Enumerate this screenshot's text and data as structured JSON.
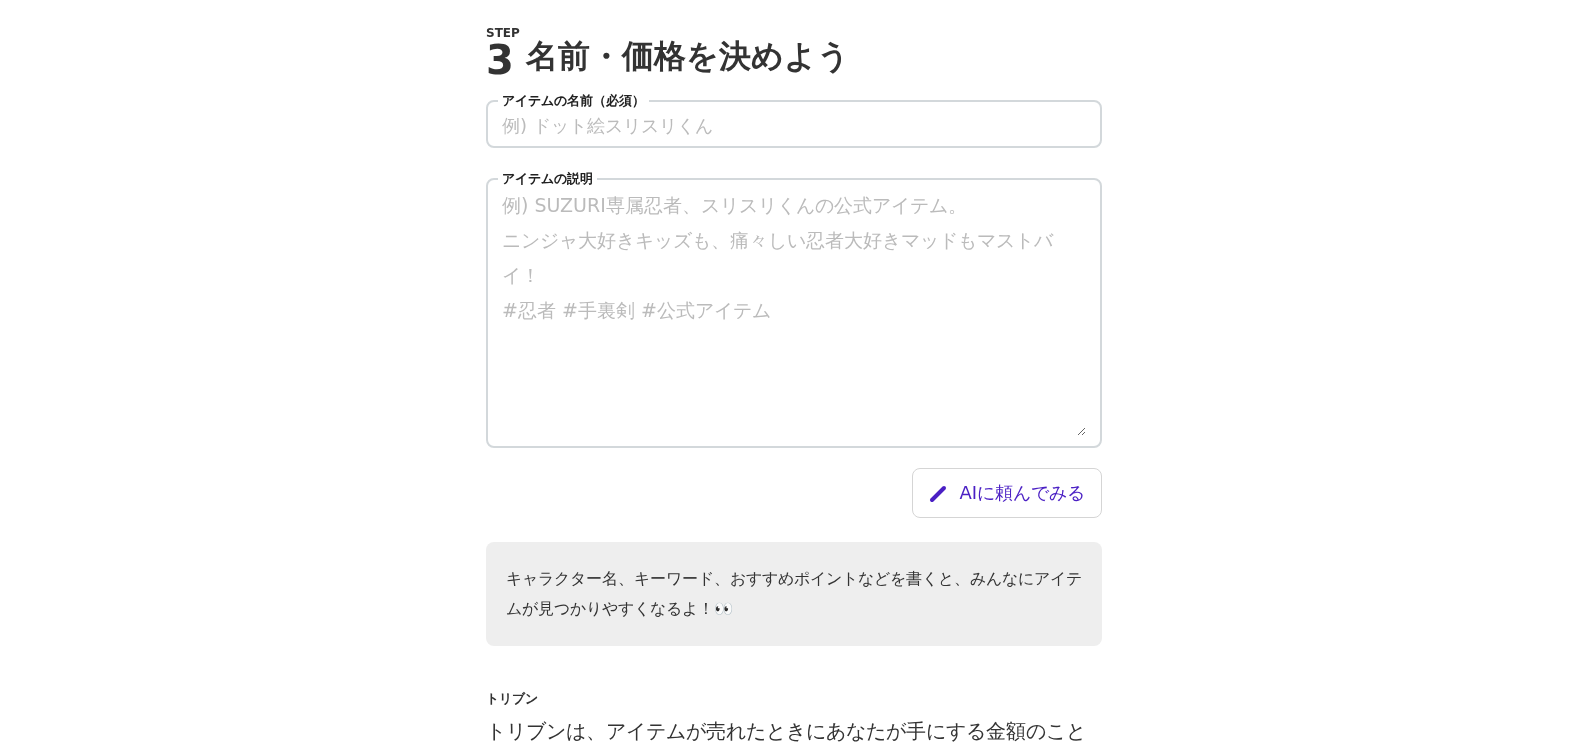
{
  "heading": {
    "step_label": "STEP",
    "step_number": "3",
    "title": "名前・価格を決めよう"
  },
  "name_field": {
    "label": "アイテムの名前（必須）",
    "placeholder": "例) ドット絵スリスリくん"
  },
  "description_field": {
    "label": "アイテムの説明",
    "placeholder_lines": [
      "例) SUZURI専属忍者、スリスリくんの公式アイテム。",
      "ニンジャ大好きキッズも、痛々しい忍者大好きマッドもマストバイ！",
      "#忍者 #手裏剣 #公式アイテム"
    ]
  },
  "ai_button": {
    "label": "AIに頼んでみる"
  },
  "hint": "キャラクター名、キーワード、おすすめポイントなどを書くと、みんなにアイテムが見つかりやすくなるよ！👀",
  "toribun": {
    "label": "トリブン",
    "text": "トリブンは、アイテムが売れたときにあなたが手にする金額のこと"
  }
}
